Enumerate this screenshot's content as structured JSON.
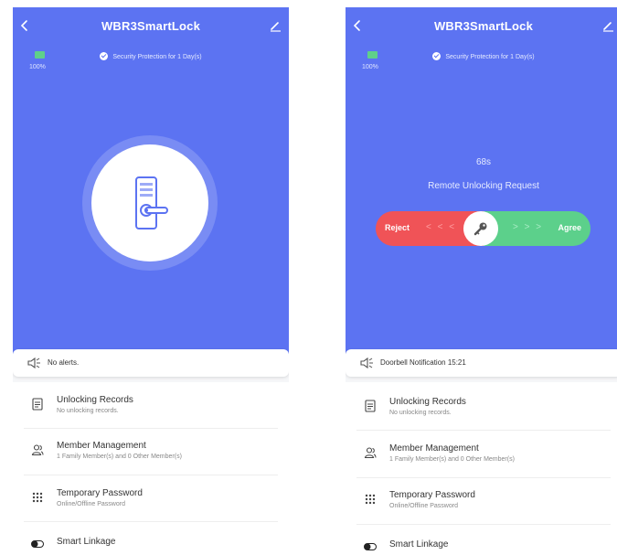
{
  "screens": [
    {
      "title": "WBR3SmartLock",
      "battery": "100%",
      "security": "Security Protection for 1 Day(s)",
      "notice": "No alerts.",
      "menu": [
        {
          "title": "Unlocking Records",
          "sub": "No unlocking records."
        },
        {
          "title": "Member Management",
          "sub": "1 Family Member(s) and 0 Other Member(s)"
        },
        {
          "title": "Temporary Password",
          "sub": "Online/Offline Password"
        },
        {
          "title": "Smart Linkage",
          "sub": ""
        }
      ]
    },
    {
      "title": "WBR3SmartLock",
      "battery": "100%",
      "security": "Security Protection for 1 Day(s)",
      "countdown": "68s",
      "remote": "Remote Unlocking Request",
      "reject": "Reject",
      "agree": "Agree",
      "arrows_left": "< < <",
      "arrows_right": "> > >",
      "notice": "Doorbell Notification 15:21",
      "menu": [
        {
          "title": "Unlocking Records",
          "sub": "No unlocking records."
        },
        {
          "title": "Member Management",
          "sub": "1 Family Member(s) and 0 Other Member(s)"
        },
        {
          "title": "Temporary Password",
          "sub": "Online/Offline Password"
        },
        {
          "title": "Smart Linkage",
          "sub": ""
        }
      ]
    }
  ],
  "colors": {
    "header_blue": "#5c73f2",
    "reject_red": "#f05357",
    "agree_green": "#5cd08b",
    "battery_green": "#5fd08a"
  },
  "icons": [
    "back-icon",
    "edit-icon",
    "battery-icon",
    "shield-check-icon",
    "door-lock-icon",
    "key-icon",
    "speaker-icon",
    "records-icon",
    "members-icon",
    "keypad-icon",
    "toggle-icon"
  ]
}
